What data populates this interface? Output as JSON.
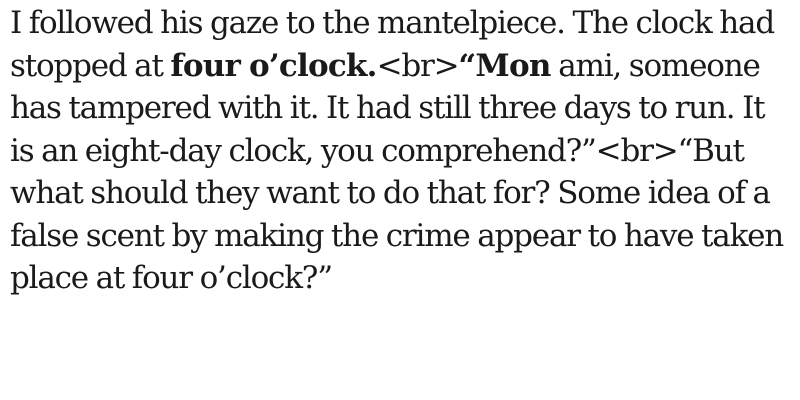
{
  "passage": {
    "seg1": "I followed his gaze to the mantelpiece. The clock had stopped at ",
    "seg2_bold": "four o’clock.",
    "seg3": "<br>",
    "seg4_bold": "“Mon",
    "seg5": " ami, someone has tampered with it. It had still three days to run. It is an eight-day clock, you comprehend?”<br>“But what should they want to do that for? Some idea of a false scent by making the crime appear to have taken place at four o’clock?”"
  }
}
